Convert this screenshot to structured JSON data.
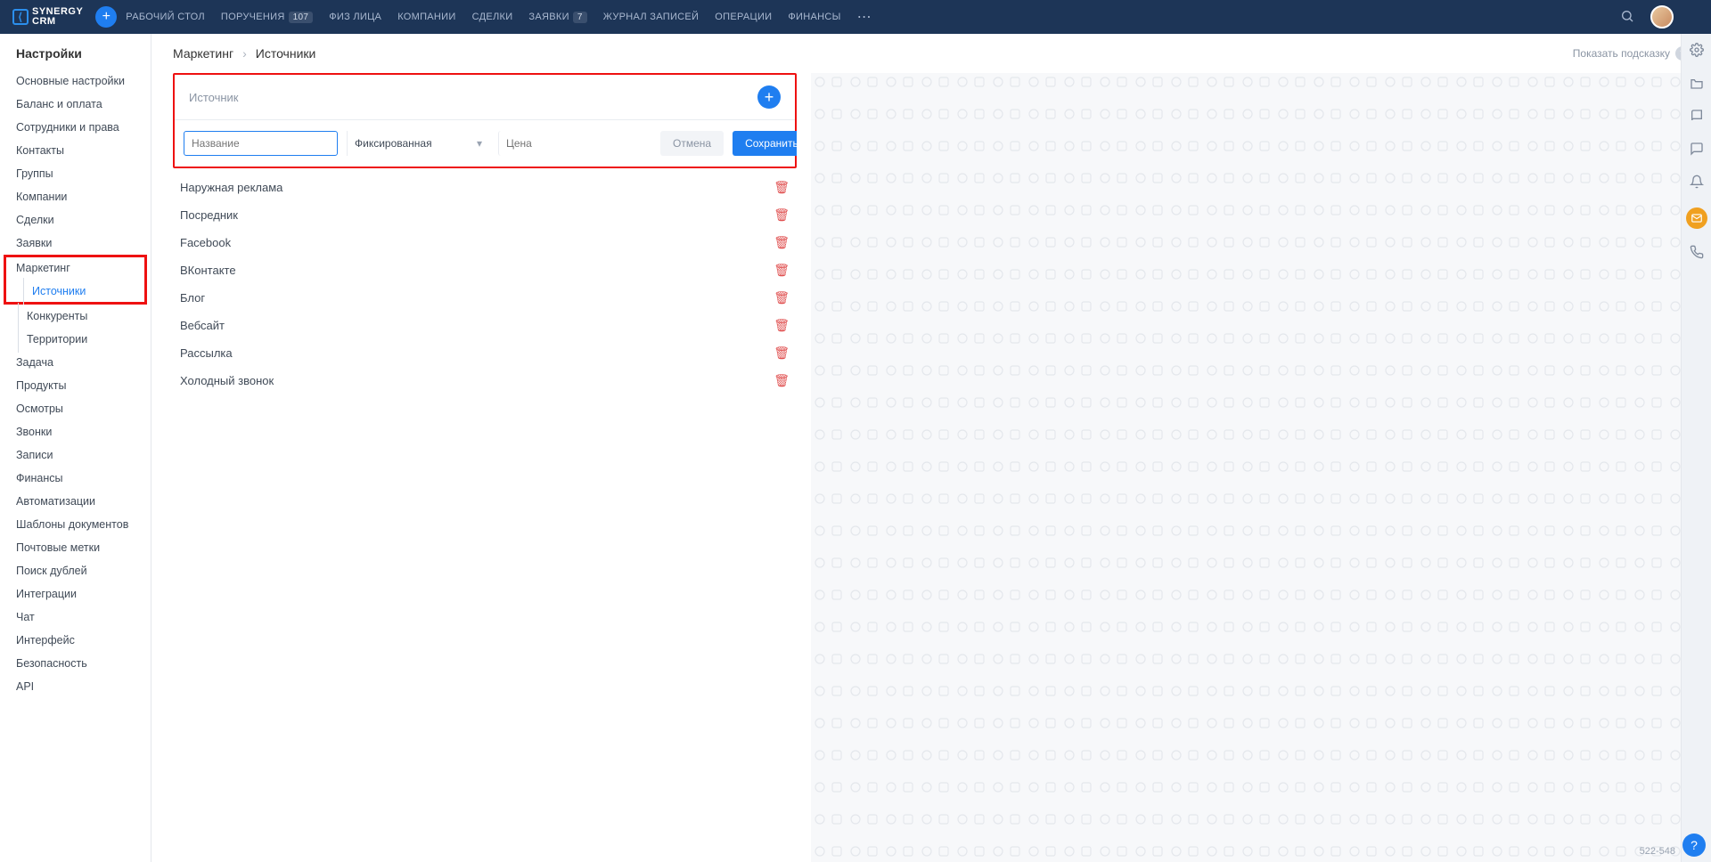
{
  "brand": {
    "line1": "SYNERGY",
    "line2": "CRM"
  },
  "topnav": {
    "items": [
      {
        "label": "РАБОЧИЙ СТОЛ"
      },
      {
        "label": "ПОРУЧЕНИЯ",
        "badge": "107"
      },
      {
        "label": "ФИЗ ЛИЦА"
      },
      {
        "label": "КОМПАНИИ"
      },
      {
        "label": "СДЕЛКИ"
      },
      {
        "label": "ЗАЯВКИ",
        "badge": "7"
      },
      {
        "label": "ЖУРНАЛ ЗАПИСЕЙ"
      },
      {
        "label": "ОПЕРАЦИИ"
      },
      {
        "label": "ФИНАНСЫ"
      }
    ]
  },
  "sidebar": {
    "title": "Настройки",
    "items": [
      "Основные настройки",
      "Баланс и оплата",
      "Сотрудники и права",
      "Контакты",
      "Группы",
      "Компании",
      "Сделки",
      "Заявки",
      "Маркетинг",
      "Задача",
      "Продукты",
      "Осмотры",
      "Звонки",
      "Записи",
      "Финансы",
      "Автоматизации",
      "Шаблоны документов",
      "Почтовые метки",
      "Поиск дублей",
      "Интеграции",
      "Чат",
      "Интерфейс",
      "Безопасность",
      "API"
    ],
    "marketing_sub": [
      "Источники",
      "Конкуренты",
      "Территории"
    ]
  },
  "breadcrumb": {
    "root": "Маркетинг",
    "leaf": "Источники"
  },
  "hint_label": "Показать подсказку",
  "card": {
    "title": "Источник",
    "name_placeholder": "Название",
    "select_value": "Фиксированная",
    "price_placeholder": "Цена",
    "cancel_label": "Отмена",
    "save_label": "Сохранить"
  },
  "sources": [
    "Наружная реклама",
    "Посредник",
    "Facebook",
    "ВКонтакте",
    "Блог",
    "Вебсайт",
    "Рассылка",
    "Холодный звонок"
  ],
  "footer_build": "522-548"
}
